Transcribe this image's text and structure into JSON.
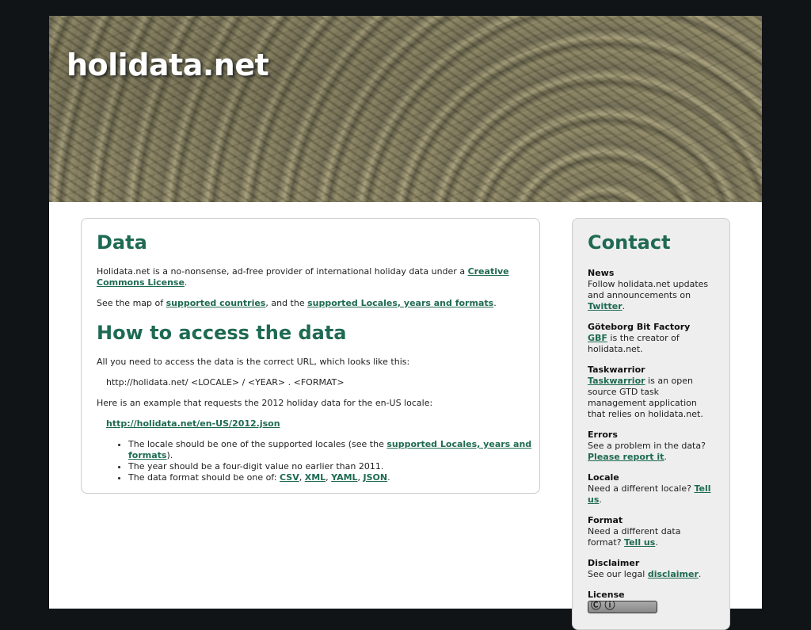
{
  "site": {
    "title": "holidata.net"
  },
  "main": {
    "data_heading": "Data",
    "intro_text": "Holidata.net is a no-nonsense, ad-free provider of international holiday data under a ",
    "intro_link": "Creative Commons License",
    "intro_end": ".",
    "map_text_1": "See the map of ",
    "map_link_1": "supported countries",
    "map_text_2": ", and the ",
    "map_link_2": "supported Locales, years and formats",
    "map_text_3": ".",
    "access_heading": "How to access the data",
    "access_text": "All you need to access the data is the correct URL, which looks like this:",
    "url_pattern": "http://holidata.net/ <LOCALE> / <YEAR> . <FORMAT>",
    "example_text": "Here is an example that requests the 2012 holiday data for the en-US locale:",
    "example_link": "http://holidata.net/en-US/2012.json",
    "bullet1_text": "The locale should be one of the supported locales (see the ",
    "bullet1_link": "supported Locales, years and formats",
    "bullet1_end": ").",
    "bullet2_text": "The year should be a four-digit value no earlier than 2011.",
    "bullet3_text": "The data format should be one of: ",
    "formats": [
      "CSV",
      "XML",
      "YAML",
      "JSON"
    ],
    "sep_comma": ", ",
    "period": "."
  },
  "contact": {
    "heading": "Contact",
    "news_title": "News",
    "news_text": "Follow holidata.net updates and announcements on ",
    "news_link": "Twitter",
    "gbf_title": "Göteborg Bit Factory",
    "gbf_link": "GBF",
    "gbf_text": " is the creator of holidata.net.",
    "tw_title": "Taskwarrior",
    "tw_link": "Taskwarrior",
    "tw_text": " is an open source GTD task management application that relies on holidata.net.",
    "errors_title": "Errors",
    "errors_text": "See a problem in the data? ",
    "errors_link": "Please report it",
    "locale_title": "Locale",
    "locale_text": "Need a different locale? ",
    "locale_link": "Tell us",
    "format_title": "Format",
    "format_text": "Need a different data format? ",
    "format_link": "Tell us",
    "disclaimer_title": "Disclaimer",
    "disclaimer_text": "See our legal ",
    "disclaimer_link": "disclaimer",
    "license_title": "License",
    "period": "."
  },
  "colors": {
    "heading": "#1e6a52",
    "background": "#111417",
    "card_side": "#eeeeee"
  }
}
